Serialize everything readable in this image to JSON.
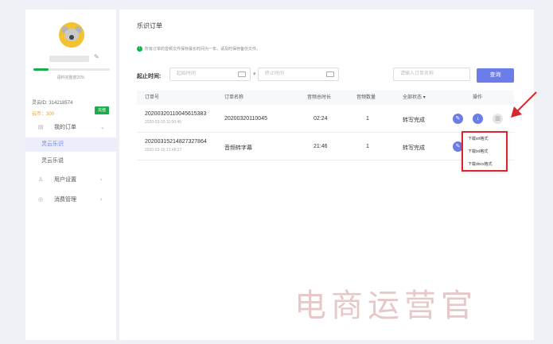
{
  "sidebar": {
    "progress_percent": 20,
    "progress_text": "语料完整度20%",
    "uid": "灵云ID: 314218574",
    "coins": "云币：300",
    "recharge": "充值",
    "menu": {
      "my_orders": "我的订单",
      "lingyun_lezhi": "灵云乐识",
      "lingyun_leshuo": "灵云乐说",
      "user_settings": "用户设置",
      "consumption": "消费管理"
    }
  },
  "main": {
    "title": "乐识订单",
    "notice": "所有订单的音频文件保存最长时间为一年，请及时保存备份文件。",
    "time_label": "起止时间:",
    "start_placeholder": "起始时间",
    "end_placeholder": "终止时间",
    "search_placeholder": "请输入订单名称",
    "query": "查询",
    "columns": {
      "order_no": "订单号",
      "order_name": "订单名称",
      "duration": "音频总时长",
      "count": "音频数量",
      "status": "全部状态",
      "actions": "操作"
    },
    "rows": [
      {
        "order_no": "20200320110045615383",
        "date": "2020-03-20 11:00:45",
        "name": "20200320110045",
        "duration": "02:24",
        "count": "1",
        "status": "转写完成"
      },
      {
        "order_no": "20200315214827327864",
        "date": "2020-03-15 21:48:27",
        "name": "音频转字幕",
        "duration": "21:46",
        "count": "1",
        "status": "转写完成"
      }
    ],
    "download_menu": [
      "下载srt格式",
      "下载txt格式",
      "下载docx格式"
    ]
  },
  "watermark": "电商运营官",
  "colors": {
    "accent": "#6b7de8",
    "green": "#1aad4b",
    "highlight": "#d7262e"
  }
}
